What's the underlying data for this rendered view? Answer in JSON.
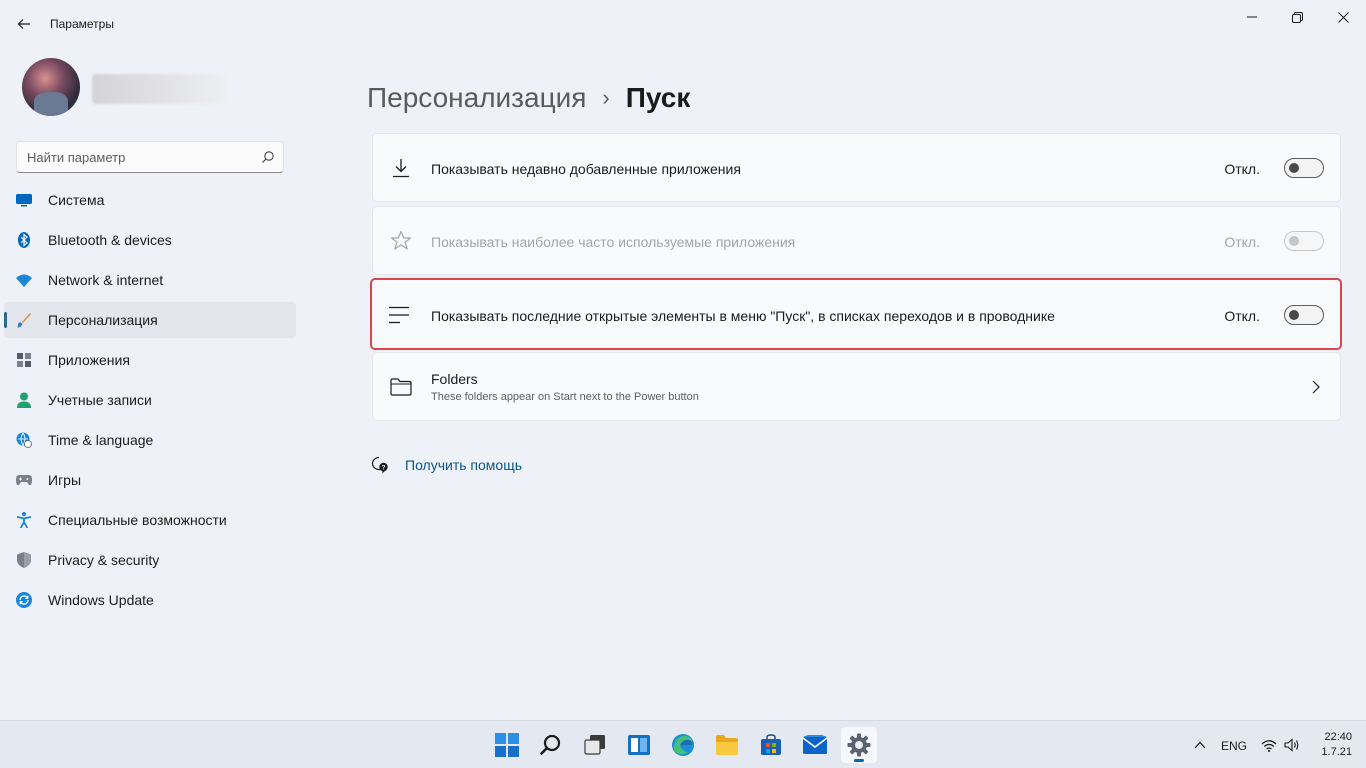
{
  "window": {
    "title": "Параметры",
    "controls": {
      "minimize": "minimize",
      "maximize": "maximize",
      "close": "close"
    }
  },
  "search": {
    "placeholder": "Найти параметр",
    "value": ""
  },
  "sidebar": {
    "items": [
      {
        "label": "Система",
        "icon": "monitor-icon",
        "color": "#0067c0"
      },
      {
        "label": "Bluetooth & devices",
        "icon": "bluetooth-icon",
        "color": "#0067c0"
      },
      {
        "label": "Network & internet",
        "icon": "wifi-icon",
        "color": "#1a86d9"
      },
      {
        "label": "Персонализация",
        "icon": "brush-icon",
        "color": "#e08a3c",
        "active": true
      },
      {
        "label": "Приложения",
        "icon": "apps-icon",
        "color": "#555a66"
      },
      {
        "label": "Учетные записи",
        "icon": "person-icon",
        "color": "#22a06b"
      },
      {
        "label": "Time & language",
        "icon": "globe-clock-icon",
        "color": "#1a86d9"
      },
      {
        "label": "Игры",
        "icon": "gamepad-icon",
        "color": "#7a7f8a"
      },
      {
        "label": "Специальные возможности",
        "icon": "accessibility-icon",
        "color": "#1a86d9"
      },
      {
        "label": "Privacy & security",
        "icon": "shield-icon",
        "color": "#7a7f8a"
      },
      {
        "label": "Windows Update",
        "icon": "update-icon",
        "color": "#1a86d9"
      }
    ]
  },
  "breadcrumb": {
    "parent": "Персонализация",
    "separator": "›",
    "current": "Пуск"
  },
  "settings": [
    {
      "label": "Показывать недавно добавленные приложения",
      "state": "Откл.",
      "on": false,
      "disabled": false,
      "icon": "download-icon"
    },
    {
      "label": "Показывать наиболее часто используемые приложения",
      "state": "Откл.",
      "on": false,
      "disabled": true,
      "icon": "star-icon"
    },
    {
      "label": "Показывать последние открытые элементы в меню \"Пуск\", в списках переходов и в проводнике",
      "state": "Откл.",
      "on": false,
      "disabled": false,
      "highlighted": true,
      "icon": "list-icon"
    },
    {
      "label": "Folders",
      "sublabel": "These folders appear on Start next to the Power button",
      "icon": "folder-icon"
    }
  ],
  "help": {
    "label": "Получить помощь"
  },
  "taskbar": {
    "apps": [
      "start-icon",
      "search-icon",
      "task-view-icon",
      "widgets-icon",
      "edge-icon",
      "file-explorer-icon",
      "store-icon",
      "mail-icon",
      "settings-icon"
    ],
    "tray": {
      "language": "ENG",
      "time": "22:40",
      "date": "1.7.21"
    }
  },
  "colors": {
    "accent": "#0067c0",
    "highlight_border": "#d8474f",
    "link": "#0b5585"
  }
}
